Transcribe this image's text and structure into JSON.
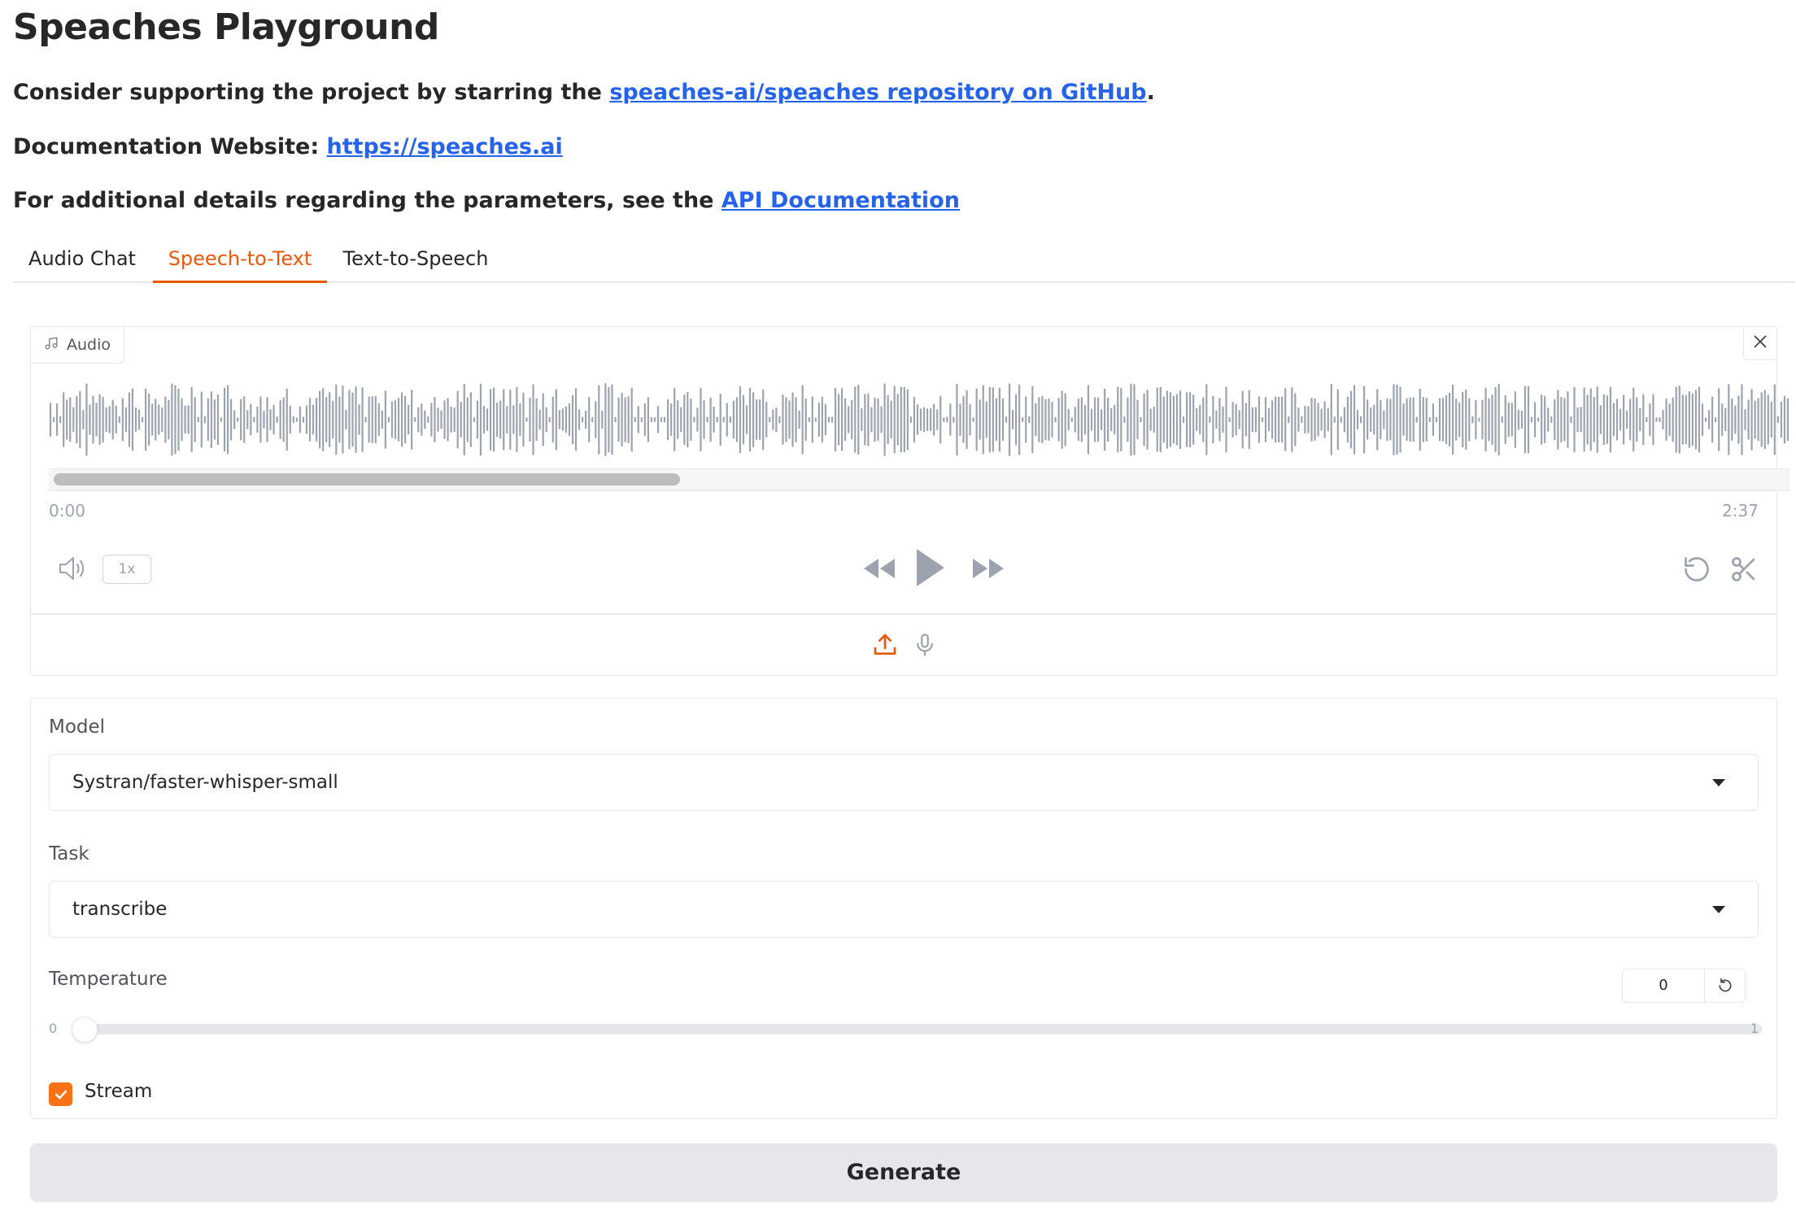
{
  "page": {
    "title": "Speaches Playground",
    "support_prefix": "Consider supporting the project by starring the ",
    "support_link": "speaches-ai/speaches repository on GitHub",
    "support_suffix": ".",
    "docs_prefix": "Documentation Website: ",
    "docs_link": "https://speaches.ai",
    "params_prefix": "For additional details regarding the parameters, see the ",
    "params_link": "API Documentation"
  },
  "tabs": [
    {
      "label": "Audio Chat",
      "active": false
    },
    {
      "label": "Speech-to-Text",
      "active": true
    },
    {
      "label": "Text-to-Speech",
      "active": false
    }
  ],
  "audio": {
    "label": "Audio",
    "current_time": "0:00",
    "duration": "2:37",
    "playback_speed": "1x",
    "icons": [
      "music-note-icon",
      "close-icon",
      "volume-icon",
      "rewind-icon",
      "play-icon",
      "fast-forward-icon",
      "undo-icon",
      "scissors-icon",
      "upload-icon",
      "microphone-icon"
    ]
  },
  "form": {
    "model_label": "Model",
    "model_value": "Systran/faster-whisper-small",
    "task_label": "Task",
    "task_value": "transcribe",
    "temperature_label": "Temperature",
    "temperature_value": "0",
    "temperature_min": "0",
    "temperature_max": "1",
    "stream_label": "Stream",
    "stream_checked": true
  },
  "actions": {
    "generate_label": "Generate"
  },
  "colors": {
    "accent": "#ea580c",
    "link": "#2563eb",
    "checkbox": "#f97316",
    "waveform": "#9ca3af"
  }
}
